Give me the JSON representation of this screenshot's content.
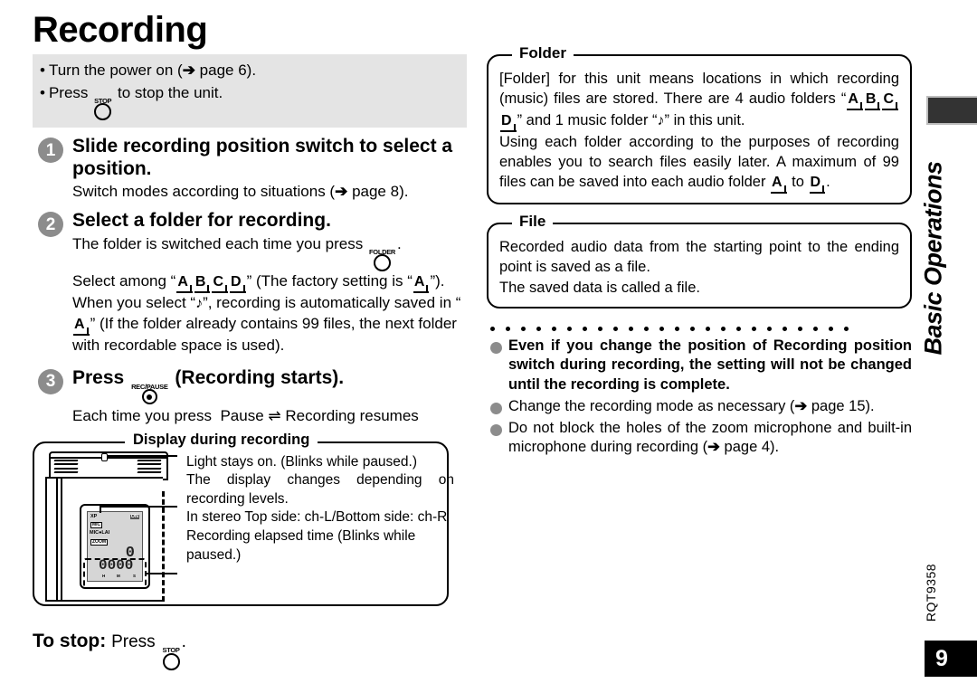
{
  "page": {
    "title": "Recording",
    "number": "9",
    "doc_code": "RQT9358",
    "section_tab": "Basic Operations"
  },
  "prep": {
    "line1_a": "Turn the power on (",
    "line1_arrow": "➔",
    "line1_b": " page 6).",
    "line2_a": "Press",
    "line2_icon_caption": "STOP",
    "line2_b": "to stop the unit."
  },
  "steps": [
    {
      "num": "1",
      "title": "Slide recording position switch to select a position.",
      "body_a": "Switch modes according to situations (",
      "body_arrow": "➔",
      "body_b": " page 8)."
    },
    {
      "num": "2",
      "title": "Select a folder for recording.",
      "folder_icon_caption": "FOLDER",
      "t1": "The folder is switched each time you press",
      "t1_end": ".",
      "t2a": "Select among “",
      "folders": [
        "A",
        "B",
        "C",
        "D"
      ],
      "t2b": "” (The factory setting is “",
      "factory_folder": "A",
      "t2c": "”).",
      "t3a": "When you select “",
      "music_icon": "♪",
      "t3b": "”, recording is automatically saved in “",
      "auto_folder": "A",
      "t3c": "” (If the folder already contains 99 files, the next folder with recordable space is used)."
    },
    {
      "num": "3",
      "title_a": "Press",
      "rec_icon_caption": "REC/PAUSE",
      "title_b": "(Recording starts).",
      "body_a": "Each time you press",
      "body_pause": "Pause",
      "body_swap": "⇌",
      "body_b": "Recording resumes"
    }
  ],
  "display_panel": {
    "legend": "Display during recording",
    "callout1": "Light stays on. (Blinks while paused.)",
    "callout2": "The display changes depending on recording levels.",
    "callout3": "In stereo Top side: ch-L/Bottom side: ch-R",
    "callout4": "Recording elapsed time (Blinks while paused.)",
    "lcd": {
      "mode": "XP",
      "ind_small": "MIC",
      "row_mic": "MIC●LAI",
      "ind_zoom": "ZOOM",
      "ind_right": "ON",
      "level_digit": "0",
      "time_digits": "0000",
      "unit_h": "H",
      "unit_m": "M",
      "unit_s": "S"
    }
  },
  "to_stop": {
    "label": "To stop:",
    "press": "Press",
    "icon_caption": "STOP",
    "period": "."
  },
  "folder_box": {
    "legend": "Folder",
    "p1a": "[Folder] for this unit means locations in which recording (music) files are stored. There are 4 audio folders “",
    "folders": [
      "A",
      "B",
      "C",
      "D"
    ],
    "p1b": "” and 1 music folder “",
    "music_icon": "♪",
    "p1c": "” in this unit.",
    "p2": "Using each folder according to the purposes of recording enables you to search files easily later. A maximum of 99 files can be saved into each audio folder ",
    "from_folder": "A",
    "p2_mid": " to ",
    "to_folder": "D",
    "p2_end": "."
  },
  "file_box": {
    "legend": "File",
    "p1": "Recorded audio data from the starting point to the ending point is saved as a file.",
    "p2": "The saved data is called a file."
  },
  "notes": [
    {
      "bold": true,
      "text": "Even if you change the position of Recording position switch during recording, the setting will not be changed until the recording is complete."
    },
    {
      "bold": false,
      "text_a": "Change the recording mode as necessary (",
      "arrow": "➔",
      "text_b": " page 15)."
    },
    {
      "bold": false,
      "text_a": "Do not block the holes of the zoom microphone and built-in microphone during recording (",
      "arrow": "➔",
      "text_b": " page 4)."
    }
  ],
  "colors": {
    "band_gray": "#e4e4e4",
    "step_circle": "#8c8c8c",
    "tab_black": "#333333",
    "page_badge": "#000000"
  }
}
